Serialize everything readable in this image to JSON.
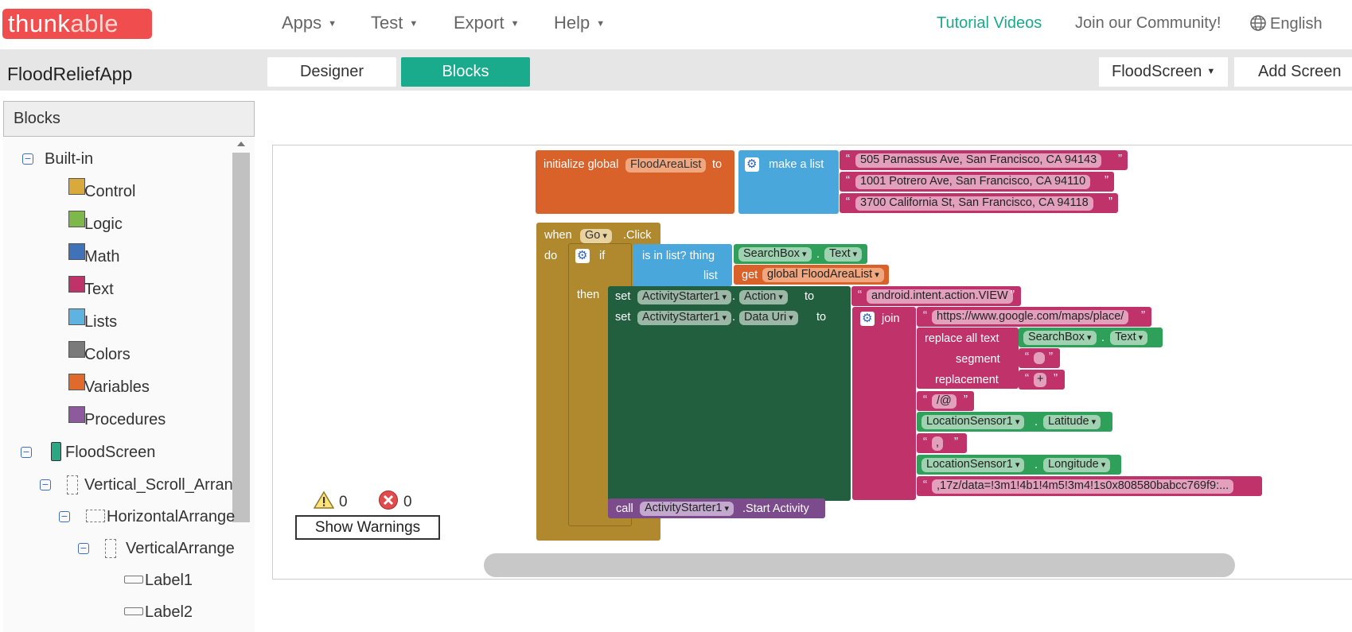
{
  "header": {
    "logo_text": "thunk",
    "logo_text2": "able",
    "menus": [
      "Apps",
      "Test",
      "Export",
      "Help"
    ],
    "tutorial_link": "Tutorial Videos",
    "community_link": "Join our Community!",
    "language": "English",
    "colors": {
      "brand": "#f04e4e",
      "tutorial": "#1aaa8c"
    }
  },
  "project": {
    "name": "FloodReliefApp",
    "designer_tab": "Designer",
    "blocks_tab": "Blocks",
    "screen": "FloodScreen",
    "add_screen": "Add Screen"
  },
  "palette": {
    "title": "Blocks",
    "builtin_label": "Built-in",
    "builtin": [
      {
        "label": "Control",
        "color": "#d9a93b"
      },
      {
        "label": "Logic",
        "color": "#7fb84a"
      },
      {
        "label": "Math",
        "color": "#3f72b9"
      },
      {
        "label": "Text",
        "color": "#c0336a"
      },
      {
        "label": "Lists",
        "color": "#5fb3e0"
      },
      {
        "label": "Colors",
        "color": "#7a7a7a"
      },
      {
        "label": "Variables",
        "color": "#e06a2c"
      },
      {
        "label": "Procedures",
        "color": "#8e5a9e"
      }
    ],
    "components": {
      "screen": "FloodScreen",
      "vscroll": "Vertical_Scroll_Arran",
      "harr": "HorizontalArrange",
      "varr": "VerticalArrange",
      "label1": "Label1",
      "label2": "Label2"
    }
  },
  "blocks": {
    "init": {
      "kw": "initialize global",
      "var": "FloodAreaList",
      "to": "to",
      "make_list": "make a list",
      "items": [
        "505 Parnassus Ave, San Francisco, CA 94143",
        "1001 Potrero Ave, San Francisco, CA 94110",
        "3700 California St, San Francisco, CA 94118"
      ]
    },
    "event": {
      "when": "when",
      "component": "Go",
      "event": ".Click",
      "do": "do",
      "if": "if",
      "then": "then",
      "is_in_list": "is in list? thing",
      "list": "list",
      "searchbox": "SearchBox",
      "text_prop": "Text",
      "get": "get",
      "get_var": "global FloodAreaList",
      "set": "set",
      "to": "to",
      "starter": "ActivityStarter1",
      "action_prop": "Action",
      "action_value": "android.intent.action.VIEW",
      "datauri_prop": "Data Uri",
      "join": "join",
      "url": "https://www.google.com/maps/place/",
      "replace_all": "replace all text",
      "segment": "segment",
      "replacement": "replacement",
      "seg_val": " ",
      "rep_val": "+",
      "at_val": "/@",
      "loc": "LocationSensor1",
      "lat": "Latitude",
      "comma": ",",
      "lon": "Longitude",
      "data_tail": ",17z/data=!3m1!4b1!4m5!3m4!1s0x808580babcc769f9:...",
      "call": "call",
      "start_activity": ".Start Activity",
      "dot": "."
    }
  },
  "warnings": {
    "warning_count": "0",
    "error_count": "0",
    "button": "Show Warnings"
  }
}
